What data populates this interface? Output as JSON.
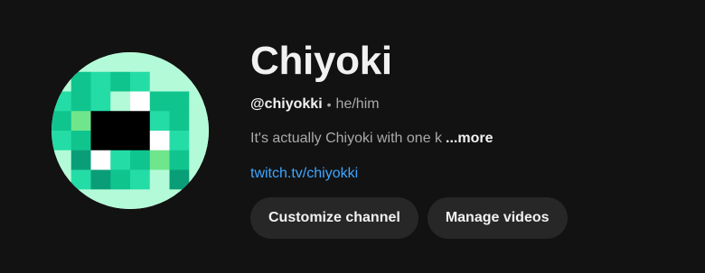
{
  "channel": {
    "name": "Chiyoki",
    "handle": "@chiyokki",
    "separator": "•",
    "pronouns": "he/him",
    "description_preview": "It's actually Chiyoki with one k",
    "more_label": "...more",
    "link": "twitch.tv/chiyokki"
  },
  "actions": {
    "customize_label": "Customize channel",
    "manage_label": "Manage videos"
  },
  "avatar": {
    "icon": "pixel-eye-avatar",
    "colors": {
      "light_mint": "#b3fbd8",
      "teal": "#10c48e",
      "mint": "#24dca6",
      "green": "#6fe68c",
      "dark_teal": "#0a9e78",
      "black": "#000000",
      "white": "#ffffff"
    }
  },
  "theme": {
    "background": "#121212",
    "text_primary": "#f1f1f1",
    "text_secondary": "#aaaaaa",
    "link": "#3ea6ff",
    "button_bg": "#272727"
  }
}
